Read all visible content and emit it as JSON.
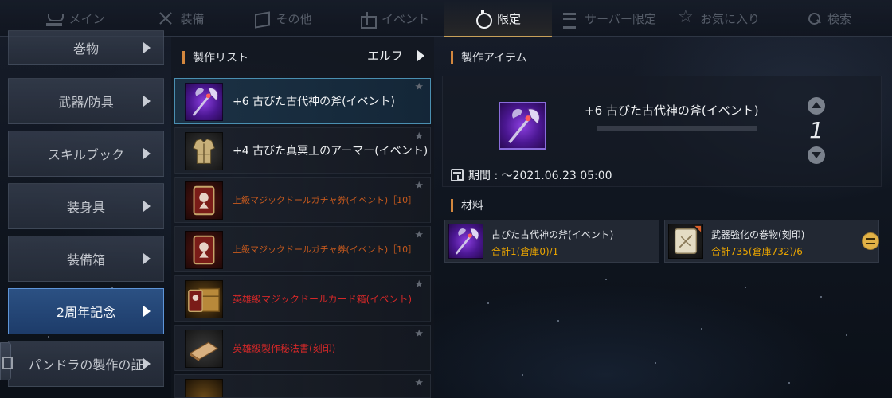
{
  "tabs": [
    {
      "label": "メイン",
      "icon": "crown-icon",
      "active": false
    },
    {
      "label": "装備",
      "icon": "swords-icon",
      "active": false
    },
    {
      "label": "その他",
      "icon": "box-icon",
      "active": false
    },
    {
      "label": "イベント",
      "icon": "gift-icon",
      "active": false
    },
    {
      "label": "限定",
      "icon": "timer-icon",
      "active": true
    },
    {
      "label": "サーバー限定",
      "icon": "server-icon",
      "active": false
    },
    {
      "label": "お気に入り",
      "icon": "star-icon",
      "active": false
    },
    {
      "label": "検索",
      "icon": "search-icon",
      "active": false
    }
  ],
  "categories": [
    {
      "label": "巻物"
    },
    {
      "label": "武器/防具"
    },
    {
      "label": "スキルブック"
    },
    {
      "label": "装身具"
    },
    {
      "label": "装備箱"
    },
    {
      "label": "2周年記念",
      "selected": true
    },
    {
      "label": "パンドラの製作の証"
    }
  ],
  "craft_list": {
    "header": "製作リスト",
    "filter": "エルフ",
    "items": [
      {
        "name": "+6  古びた古代神の斧(イベント)",
        "icon": "axe-icon",
        "style": "normal",
        "selected": true
      },
      {
        "name": "+4  古びた真冥王のアーマー(イベント)",
        "icon": "armor-icon",
        "style": "normal"
      },
      {
        "name": "上級マジックドールガチャ券(イベント)［10］",
        "icon": "doll-ticket-icon",
        "style": "small"
      },
      {
        "name": "上級マジックドールガチャ券(イベント)［10］",
        "icon": "doll-ticket-icon",
        "style": "small"
      },
      {
        "name": "英雄級マジックドールカード箱(イベント)",
        "icon": "doll-card-chest-icon",
        "style": "red"
      },
      {
        "name": "英雄級製作秘法書(刻印)",
        "icon": "recipe-book-icon",
        "style": "red"
      },
      {
        "name": "",
        "icon": "chest-icon",
        "style": "normal"
      }
    ]
  },
  "craft_item": {
    "header": "製作アイテム",
    "name": "+6  古びた古代神の斧(イベント)",
    "quantity": "1",
    "period": "期間 : ～2021.06.23  05:00"
  },
  "materials": {
    "header": "材料",
    "items": [
      {
        "name": "古びた古代神の斧(イベント)",
        "total": "合計1(倉庫0)/1",
        "icon": "axe-icon"
      },
      {
        "name": "武器強化の巻物(刻印)",
        "total": "合計735(倉庫732)/6",
        "icon": "scroll-icon"
      }
    ]
  },
  "colors": {
    "accent_gold": "#c8a15a",
    "section_bar": "#d3873e",
    "selected_blue": "#5e95d8",
    "material_total": "#e9a400",
    "red_item": "#d42828"
  }
}
